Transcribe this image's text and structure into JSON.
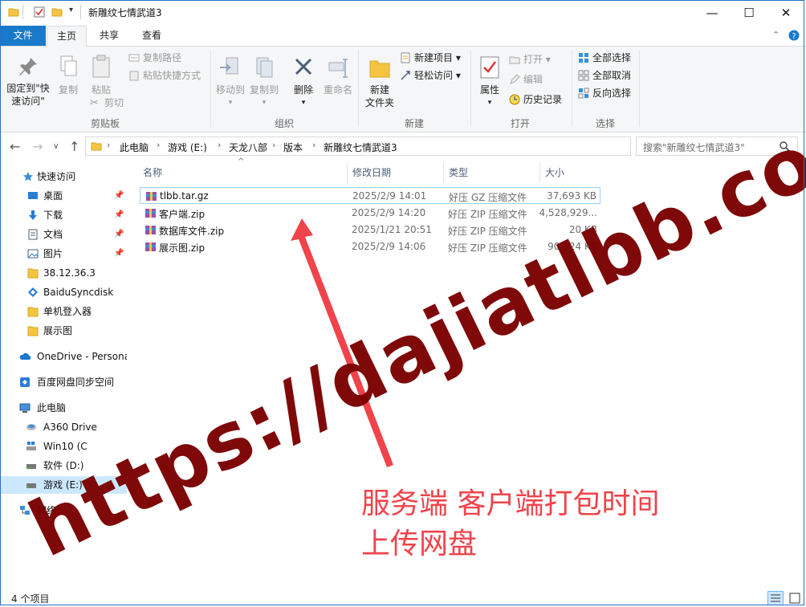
{
  "window": {
    "title": "新雕纹七情武道3",
    "controls": {
      "minimize": "—",
      "maximize": "☐",
      "close": "✕"
    }
  },
  "tabs": [
    {
      "label": "文件"
    },
    {
      "label": "主页"
    },
    {
      "label": "共享"
    },
    {
      "label": "查看"
    }
  ],
  "ribbon": {
    "clipboard": {
      "label": "剪贴板",
      "pin_line1": "固定到\"快",
      "pin_line2": "速访问\"",
      "copy": "复制",
      "paste": "粘贴",
      "copy_path": "复制路径",
      "paste_shortcut": "粘贴快捷方式",
      "cut": "剪切"
    },
    "organize": {
      "label": "组织",
      "move_to": "移动到",
      "copy_to": "复制到",
      "delete": "删除",
      "rename": "重命名"
    },
    "new": {
      "label": "新建",
      "new_folder_line1": "新建",
      "new_folder_line2": "文件夹",
      "new_item": "新建项目",
      "easy_access": "轻松访问"
    },
    "open": {
      "label": "打开",
      "properties": "属性",
      "open": "打开",
      "edit": "编辑",
      "history": "历史记录"
    },
    "select": {
      "label": "选择",
      "select_all": "全部选择",
      "select_none": "全部取消",
      "invert": "反向选择"
    }
  },
  "address": {
    "crumbs": [
      "此电脑",
      "游戏 (E:)",
      "天龙八部",
      "版本",
      "新雕纹七情武道3"
    ],
    "search_placeholder": "搜索\"新雕纹七情武道3\""
  },
  "nav": [
    {
      "label": "快速访问",
      "icon": "star-icon",
      "pinned": false
    },
    {
      "label": "桌面",
      "icon": "desktop-icon",
      "pinned": true
    },
    {
      "label": "下载",
      "icon": "download-icon",
      "pinned": true
    },
    {
      "label": "文档",
      "icon": "document-icon",
      "pinned": true
    },
    {
      "label": "图片",
      "icon": "picture-icon",
      "pinned": true
    },
    {
      "label": "38.12.36.3",
      "icon": "folder-icon",
      "pinned": false
    },
    {
      "label": "BaiduSyncdisk",
      "icon": "baidu-sync-icon",
      "pinned": false
    },
    {
      "label": "单机登入器",
      "icon": "folder-icon",
      "pinned": false
    },
    {
      "label": "展示图",
      "icon": "folder-icon",
      "pinned": false
    },
    {
      "label": "OneDrive - Persona",
      "icon": "onedrive-icon",
      "pinned": false
    },
    {
      "label": "百度网盘同步空间",
      "icon": "baidu-netdisk-icon",
      "pinned": false
    },
    {
      "label": "此电脑",
      "icon": "computer-icon",
      "pinned": false
    },
    {
      "label": "A360 Drive",
      "icon": "a360-drive-icon",
      "pinned": false
    },
    {
      "label": "Win10 (C",
      "icon": "windows-drive-icon",
      "pinned": false
    },
    {
      "label": "软件 (D:)",
      "icon": "drive-icon",
      "pinned": false
    },
    {
      "label": "游戏 (E:)",
      "icon": "drive-icon",
      "pinned": false
    },
    {
      "label": "网络",
      "icon": "network-icon",
      "pinned": false
    }
  ],
  "columns": {
    "name": "名称",
    "modified": "修改日期",
    "type": "类型",
    "size": "大小"
  },
  "files": [
    {
      "name": "tlbb.tar.gz",
      "modified": "2025/2/9 14:01",
      "type": "好压 GZ 压缩文件",
      "size": "37,693 KB"
    },
    {
      "name": "客户端.zip",
      "modified": "2025/2/9 14:20",
      "type": "好压 ZIP 压缩文件",
      "size": "4,528,929..."
    },
    {
      "name": "数据库文件.zip",
      "modified": "2025/1/21 20:51",
      "type": "好压 ZIP 压缩文件",
      "size": "20 KB"
    },
    {
      "name": "展示图.zip",
      "modified": "2025/2/9 14:06",
      "type": "好压 ZIP 压缩文件",
      "size": "90,124 KB"
    }
  ],
  "status": {
    "count": "4 个项目"
  },
  "overlay": {
    "watermark": "https://dajiatlbb.com/",
    "note_line1": "服务端 客户端打包时间",
    "note_line2": "上传网盘"
  },
  "colors": {
    "accent": "#1979ca",
    "selection": "#cce8ff",
    "watermark": "#7a0000",
    "annotation": "#f0434b"
  }
}
